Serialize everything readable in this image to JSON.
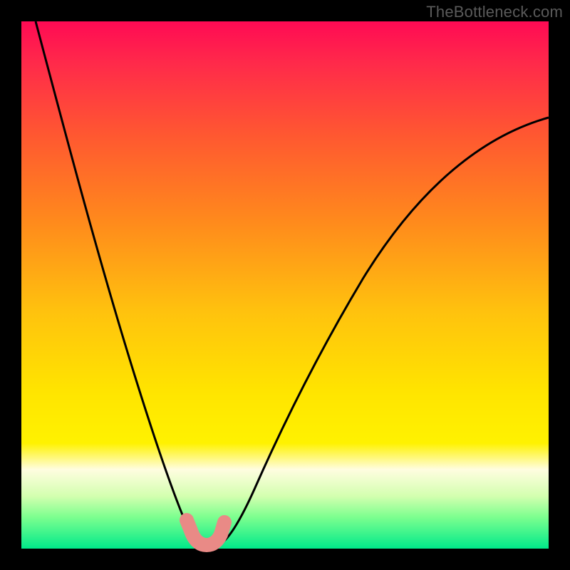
{
  "watermark": "TheBottleneck.com",
  "colors": {
    "frame": "#000000",
    "curve": "#000000",
    "worm": "#e98a86",
    "gradient_top": "#ff0a54",
    "gradient_bottom": "#00e98a"
  },
  "chart_data": {
    "type": "line",
    "title": "",
    "xlabel": "",
    "ylabel": "",
    "xlim": [
      0,
      100
    ],
    "ylim": [
      0,
      100
    ],
    "note": "Bottleneck-style V curve. y≈0 is optimal (green), y≈100 is worst (red). x is an implicit parameter ratio. Values read from plot geometry.",
    "series": [
      {
        "name": "left-branch",
        "x": [
          3,
          6,
          10,
          14,
          18,
          22,
          25,
          28,
          30,
          31.5,
          33,
          34
        ],
        "values": [
          100,
          90,
          76,
          62,
          48,
          34,
          23,
          13,
          6,
          2.5,
          1,
          0.5
        ]
      },
      {
        "name": "right-branch",
        "x": [
          37,
          38.5,
          41,
          45,
          50,
          56,
          63,
          71,
          80,
          90,
          100
        ],
        "values": [
          0.5,
          2,
          6,
          14,
          24,
          36,
          48,
          59,
          69,
          77,
          82
        ]
      },
      {
        "name": "bottom-worm-marker",
        "x": [
          31,
          32,
          33.5,
          35.5,
          37,
          38
        ],
        "values": [
          5,
          2,
          0.5,
          0.5,
          2,
          5
        ]
      }
    ]
  }
}
